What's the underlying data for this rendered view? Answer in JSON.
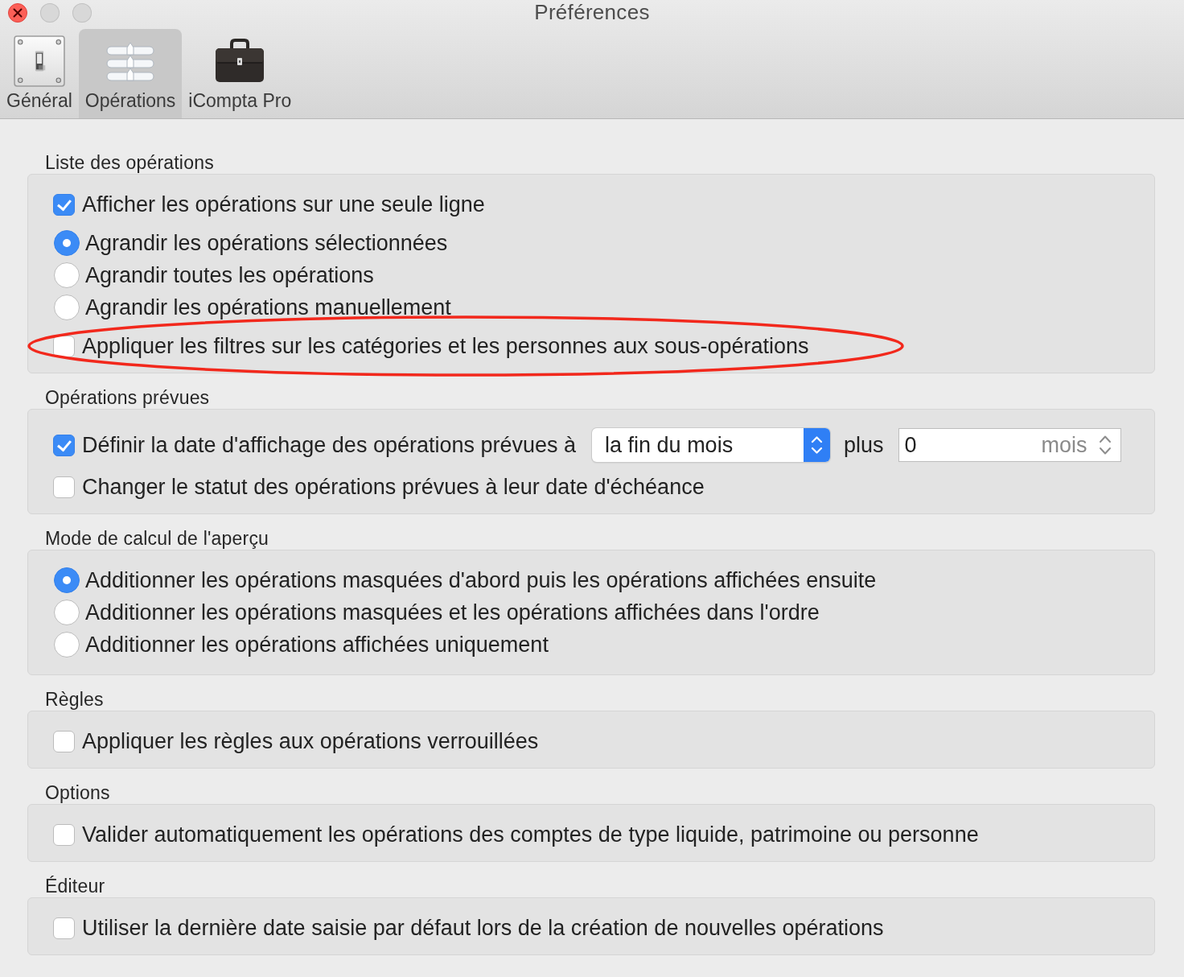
{
  "window": {
    "title": "Préférences"
  },
  "toolbar": {
    "tabs": [
      {
        "label": "Général",
        "selected": false
      },
      {
        "label": "Opérations",
        "selected": true
      },
      {
        "label": "iCompta Pro",
        "selected": false
      }
    ]
  },
  "sections": [
    {
      "heading": "Liste des opérations",
      "items": [
        {
          "kind": "checkbox",
          "label": "Afficher les opérations sur une seule ligne",
          "checked": true,
          "circled": false
        },
        {
          "kind": "radio",
          "label": "Agrandir les opérations sélectionnées",
          "selected": true,
          "circled": false
        },
        {
          "kind": "radio",
          "label": "Agrandir toutes les opérations",
          "selected": false,
          "circled": false
        },
        {
          "kind": "radio",
          "label": "Agrandir les opérations manuellement",
          "selected": false,
          "circled": false
        },
        {
          "kind": "checkbox",
          "label": "Appliquer les filtres sur les catégories et les personnes aux sous-opérations",
          "checked": false,
          "circled": true
        }
      ]
    },
    {
      "heading": "Opérations prévues",
      "items": [
        {
          "kind": "checkbox",
          "label": "Définir la date d'affichage des opérations prévues à",
          "checked": true,
          "circled": false,
          "popup": {
            "value": "la fin du mois"
          },
          "connector": "plus",
          "number_field": {
            "value": "0",
            "unit": "mois"
          }
        },
        {
          "kind": "checkbox",
          "label": "Changer le statut des opérations prévues à leur date d'échéance",
          "checked": false,
          "circled": false
        }
      ]
    },
    {
      "heading": "Mode de calcul de l'aperçu",
      "items": [
        {
          "kind": "radio",
          "label": "Additionner les opérations masquées d'abord puis les opérations affichées ensuite",
          "selected": true,
          "circled": false
        },
        {
          "kind": "radio",
          "label": "Additionner les opérations masquées et les opérations affichées dans l'ordre",
          "selected": false,
          "circled": false
        },
        {
          "kind": "radio",
          "label": "Additionner les opérations affichées uniquement",
          "selected": false,
          "circled": false
        }
      ]
    },
    {
      "heading": "Règles",
      "items": [
        {
          "kind": "checkbox",
          "label": "Appliquer les règles aux opérations verrouillées",
          "checked": false,
          "circled": false
        }
      ]
    },
    {
      "heading": "Options",
      "items": [
        {
          "kind": "checkbox",
          "label": "Valider automatiquement les opérations des comptes de type liquide, patrimoine ou personne",
          "checked": false,
          "circled": false
        }
      ]
    },
    {
      "heading": "Éditeur",
      "items": [
        {
          "kind": "checkbox",
          "label": "Utiliser la dernière date saisie par défaut lors de la création de nouvelles opérations",
          "checked": false,
          "circled": false
        }
      ]
    }
  ]
}
